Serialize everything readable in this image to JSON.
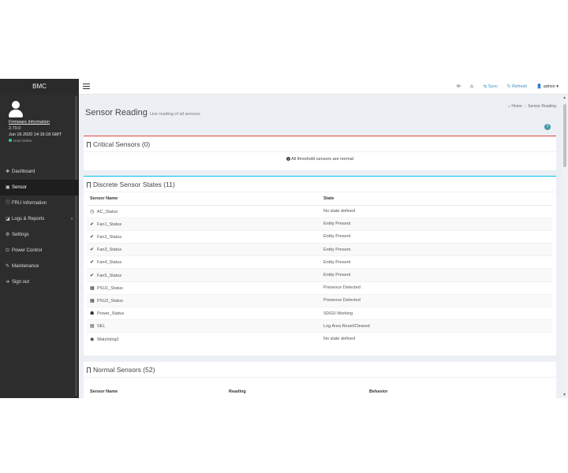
{
  "brand": "BMC",
  "user_panel": {
    "firmware_link": "Firmware Information",
    "firmware_version": "2.70.0",
    "datetime": "Jun 16 2020 14:16:18 GMT",
    "status": "Host Online"
  },
  "nav": [
    {
      "icon": "dashboard-icon",
      "glyph": "❖",
      "label": "Dashboard"
    },
    {
      "icon": "sensor-icon",
      "glyph": "▣",
      "label": "Sensor"
    },
    {
      "icon": "info-icon",
      "glyph": "ⓘ",
      "label": "FRU Information"
    },
    {
      "icon": "chart-icon",
      "glyph": "◪",
      "label": "Logs & Reports",
      "caret": "›"
    },
    {
      "icon": "gear-icon",
      "glyph": "⚙",
      "label": "Settings"
    },
    {
      "icon": "power-icon",
      "glyph": "⏻",
      "label": "Power Control"
    },
    {
      "icon": "wrench-icon",
      "glyph": "✎",
      "label": "Maintenance"
    },
    {
      "icon": "signout-icon",
      "glyph": "➜",
      "label": "Sign out"
    }
  ],
  "topbar": {
    "sync": "Sync",
    "refresh": "Refresh",
    "user": "admin"
  },
  "page": {
    "title": "Sensor Reading",
    "subtitle": "Live reading of all sensors",
    "breadcrumb_home": "Home",
    "breadcrumb_current": "Sensor Reading"
  },
  "critical": {
    "title": "Critical Sensors (0)",
    "message": "All threshold sensors are normal"
  },
  "discrete": {
    "title": "Discrete Sensor States (11)",
    "columns": [
      "Sensor Name",
      "State"
    ],
    "rows": [
      {
        "icon": "clock-icon",
        "glyph": "◷",
        "name": "AC_Status",
        "state": "No state defined"
      },
      {
        "icon": "check-icon",
        "glyph": "✔",
        "name": "Fan1_Status",
        "state": "Entity Present"
      },
      {
        "icon": "check-icon",
        "glyph": "✔",
        "name": "Fan2_Status",
        "state": "Entity Present"
      },
      {
        "icon": "check-icon",
        "glyph": "✔",
        "name": "Fan3_Status",
        "state": "Entity Present"
      },
      {
        "icon": "check-icon",
        "glyph": "✔",
        "name": "Fan4_Status",
        "state": "Entity Present"
      },
      {
        "icon": "check-icon",
        "glyph": "✔",
        "name": "Fan5_Status",
        "state": "Entity Present"
      },
      {
        "icon": "psu-icon",
        "glyph": "▦",
        "name": "PSU1_Status",
        "state": "Presence Detected"
      },
      {
        "icon": "psu-icon",
        "glyph": "▦",
        "name": "PSU2_Status",
        "state": "Presence Detected"
      },
      {
        "icon": "power-state-icon",
        "glyph": "☗",
        "name": "Power_Status",
        "state": "S0/G0 Working"
      },
      {
        "icon": "log-icon",
        "glyph": "▤",
        "name": "SEL",
        "state": "Log Area Reset/Cleared"
      },
      {
        "icon": "eye-icon",
        "glyph": "◉",
        "name": "Watchdog2",
        "state": "No state defined"
      }
    ]
  },
  "normal": {
    "title": "Normal Sensors (52)",
    "columns": [
      "Sensor Name",
      "Reading",
      "Behavior"
    ]
  }
}
